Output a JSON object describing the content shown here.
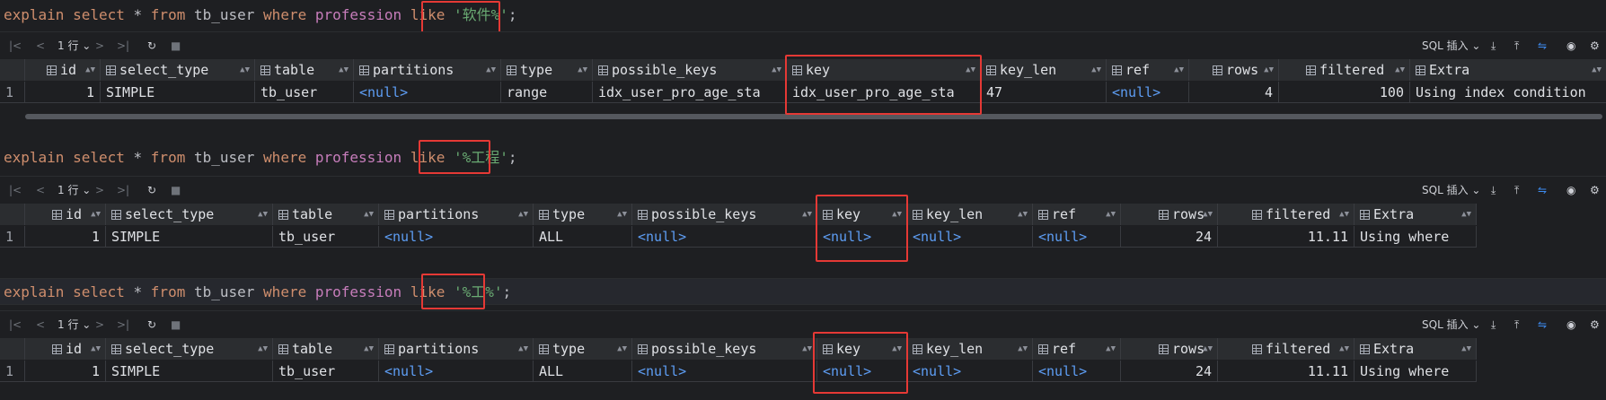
{
  "queries": [
    {
      "sql": {
        "explain": "explain",
        "select": "select",
        "star": "*",
        "from": "from",
        "table": "tb_user",
        "where": "where",
        "column": "profession",
        "like": "like",
        "literal": "'软件%'",
        "semi": ";"
      },
      "toolbar": {
        "first": "|<",
        "prev": "<",
        "rows_label": "1 行",
        "next": ">",
        "last": ">|",
        "refresh": "↻",
        "stop": "■",
        "mode": "SQL 插入",
        "download": "⤓",
        "upload": "⤒",
        "compare": "⇋",
        "view": "◉",
        "settings": "⚙"
      },
      "columns": [
        "id",
        "select_type",
        "table",
        "partitions",
        "type",
        "possible_keys",
        "key",
        "key_len",
        "ref",
        "rows",
        "filtered",
        "Extra"
      ],
      "rows": [
        [
          "1",
          "1",
          "SIMPLE",
          "tb_user",
          "<null>",
          "range",
          "idx_user_pro_age_sta",
          "idx_user_pro_age_sta",
          "47",
          "<null>",
          "4",
          "100",
          "Using index condition"
        ]
      ]
    },
    {
      "sql": {
        "explain": "explain",
        "select": "select",
        "star": "*",
        "from": "from",
        "table": "tb_user",
        "where": "where",
        "column": "profession",
        "like": "like",
        "literal": "'%工程'",
        "semi": ";"
      },
      "toolbar": {
        "first": "|<",
        "prev": "<",
        "rows_label": "1 行",
        "next": ">",
        "last": ">|",
        "refresh": "↻",
        "stop": "■",
        "mode": "SQL 插入",
        "download": "⤓",
        "upload": "⤒",
        "compare": "⇋",
        "view": "◉",
        "settings": "⚙"
      },
      "columns": [
        "id",
        "select_type",
        "table",
        "partitions",
        "type",
        "possible_keys",
        "key",
        "key_len",
        "ref",
        "rows",
        "filtered",
        "Extra"
      ],
      "rows": [
        [
          "1",
          "1",
          "SIMPLE",
          "tb_user",
          "<null>",
          "ALL",
          "<null>",
          "<null>",
          "<null>",
          "<null>",
          "24",
          "11.11",
          "Using where"
        ]
      ]
    },
    {
      "sql": {
        "explain": "explain",
        "select": "select",
        "star": "*",
        "from": "from",
        "table": "tb_user",
        "where": "where",
        "column": "profession",
        "like": "like",
        "literal": "'%工%'",
        "semi": ";"
      },
      "toolbar": {
        "first": "|<",
        "prev": "<",
        "rows_label": "1 行",
        "next": ">",
        "last": ">|",
        "refresh": "↻",
        "stop": "■",
        "mode": "SQL 插入",
        "download": "⤓",
        "upload": "⤒",
        "compare": "⇋",
        "view": "◉",
        "settings": "⚙"
      },
      "columns": [
        "id",
        "select_type",
        "table",
        "partitions",
        "type",
        "possible_keys",
        "key",
        "key_len",
        "ref",
        "rows",
        "filtered",
        "Extra"
      ],
      "rows": [
        [
          "1",
          "1",
          "SIMPLE",
          "tb_user",
          "<null>",
          "ALL",
          "<null>",
          "<null>",
          "<null>",
          "<null>",
          "24",
          "11.11",
          "Using where"
        ]
      ]
    }
  ],
  "colors": {
    "keyword": "#cf8e6d",
    "string": "#6aab73",
    "null": "#5e9ef5",
    "highlight": "#e53935",
    "background": "#1e1f22"
  },
  "icons": {
    "column": "table-column-icon",
    "sort": "sort-arrows-icon"
  }
}
